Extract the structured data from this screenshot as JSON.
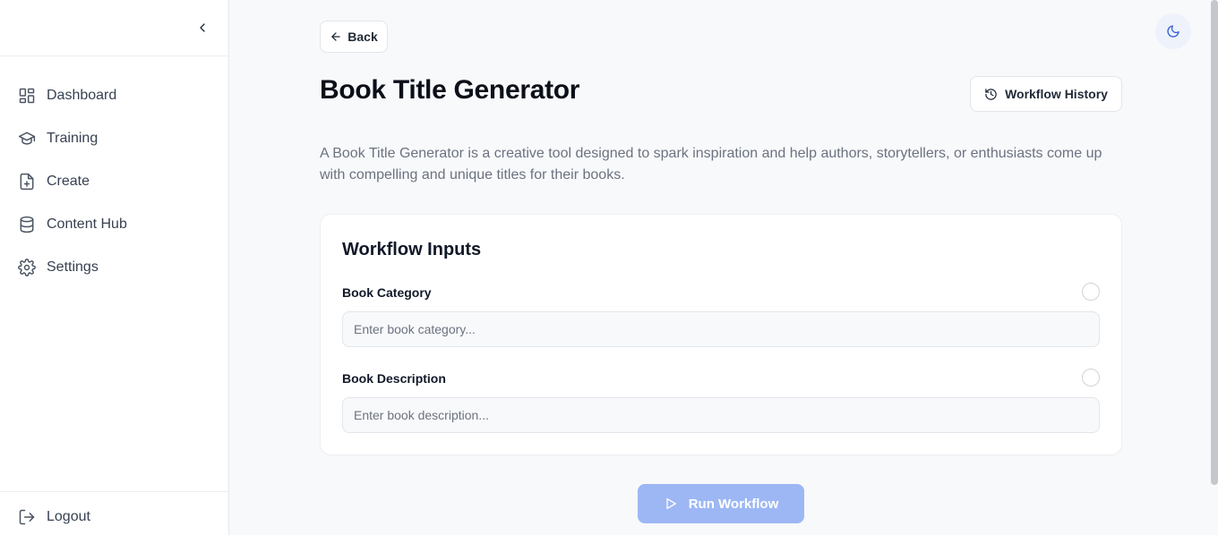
{
  "sidebar": {
    "items": [
      {
        "label": "Dashboard",
        "icon": "dashboard-icon"
      },
      {
        "label": "Training",
        "icon": "graduation-cap-icon"
      },
      {
        "label": "Create",
        "icon": "file-plus-icon"
      },
      {
        "label": "Content Hub",
        "icon": "database-icon"
      },
      {
        "label": "Settings",
        "icon": "gear-icon"
      }
    ],
    "logout_label": "Logout"
  },
  "header": {
    "back_label": "Back",
    "title": "Book Title Generator",
    "history_label": "Workflow History"
  },
  "description": "A Book Title Generator is a creative tool designed to spark inspiration and help authors, storytellers, or enthusiasts come up with compelling and unique titles for their books.",
  "inputs": {
    "title": "Workflow Inputs",
    "fields": [
      {
        "label": "Book Category",
        "placeholder": "Enter book category...",
        "value": ""
      },
      {
        "label": "Book Description",
        "placeholder": "Enter book description...",
        "value": ""
      }
    ]
  },
  "run_label": "Run Workflow",
  "colors": {
    "accent": "#9db7f5",
    "text_primary": "#111827",
    "text_muted": "#6b7280",
    "background": "#f8f9fb"
  }
}
